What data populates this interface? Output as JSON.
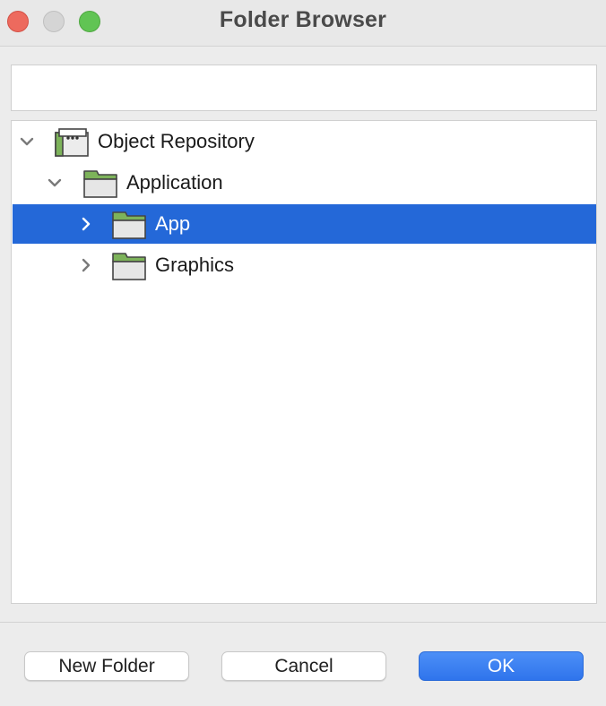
{
  "window": {
    "title": "Folder Browser"
  },
  "search": {
    "value": "",
    "placeholder": ""
  },
  "tree": {
    "root": {
      "label": "Object Repository",
      "expanded": true
    },
    "application": {
      "label": "Application",
      "expanded": true
    },
    "app": {
      "label": "App",
      "expanded": false,
      "selected": true
    },
    "graphics": {
      "label": "Graphics",
      "expanded": false,
      "selected": false
    }
  },
  "buttons": {
    "new_folder": "New Folder",
    "cancel": "Cancel",
    "ok": "OK"
  },
  "colors": {
    "selection": "#2468d8",
    "folder_tab": "#7db35a",
    "primary_button": "#3a7ff0",
    "close": "#ed6a5e",
    "zoom": "#61c454"
  },
  "icons": {
    "repository": "repository-icon",
    "folder": "folder-icon",
    "expanded": "chevron-down-icon",
    "collapsed": "chevron-right-icon"
  }
}
